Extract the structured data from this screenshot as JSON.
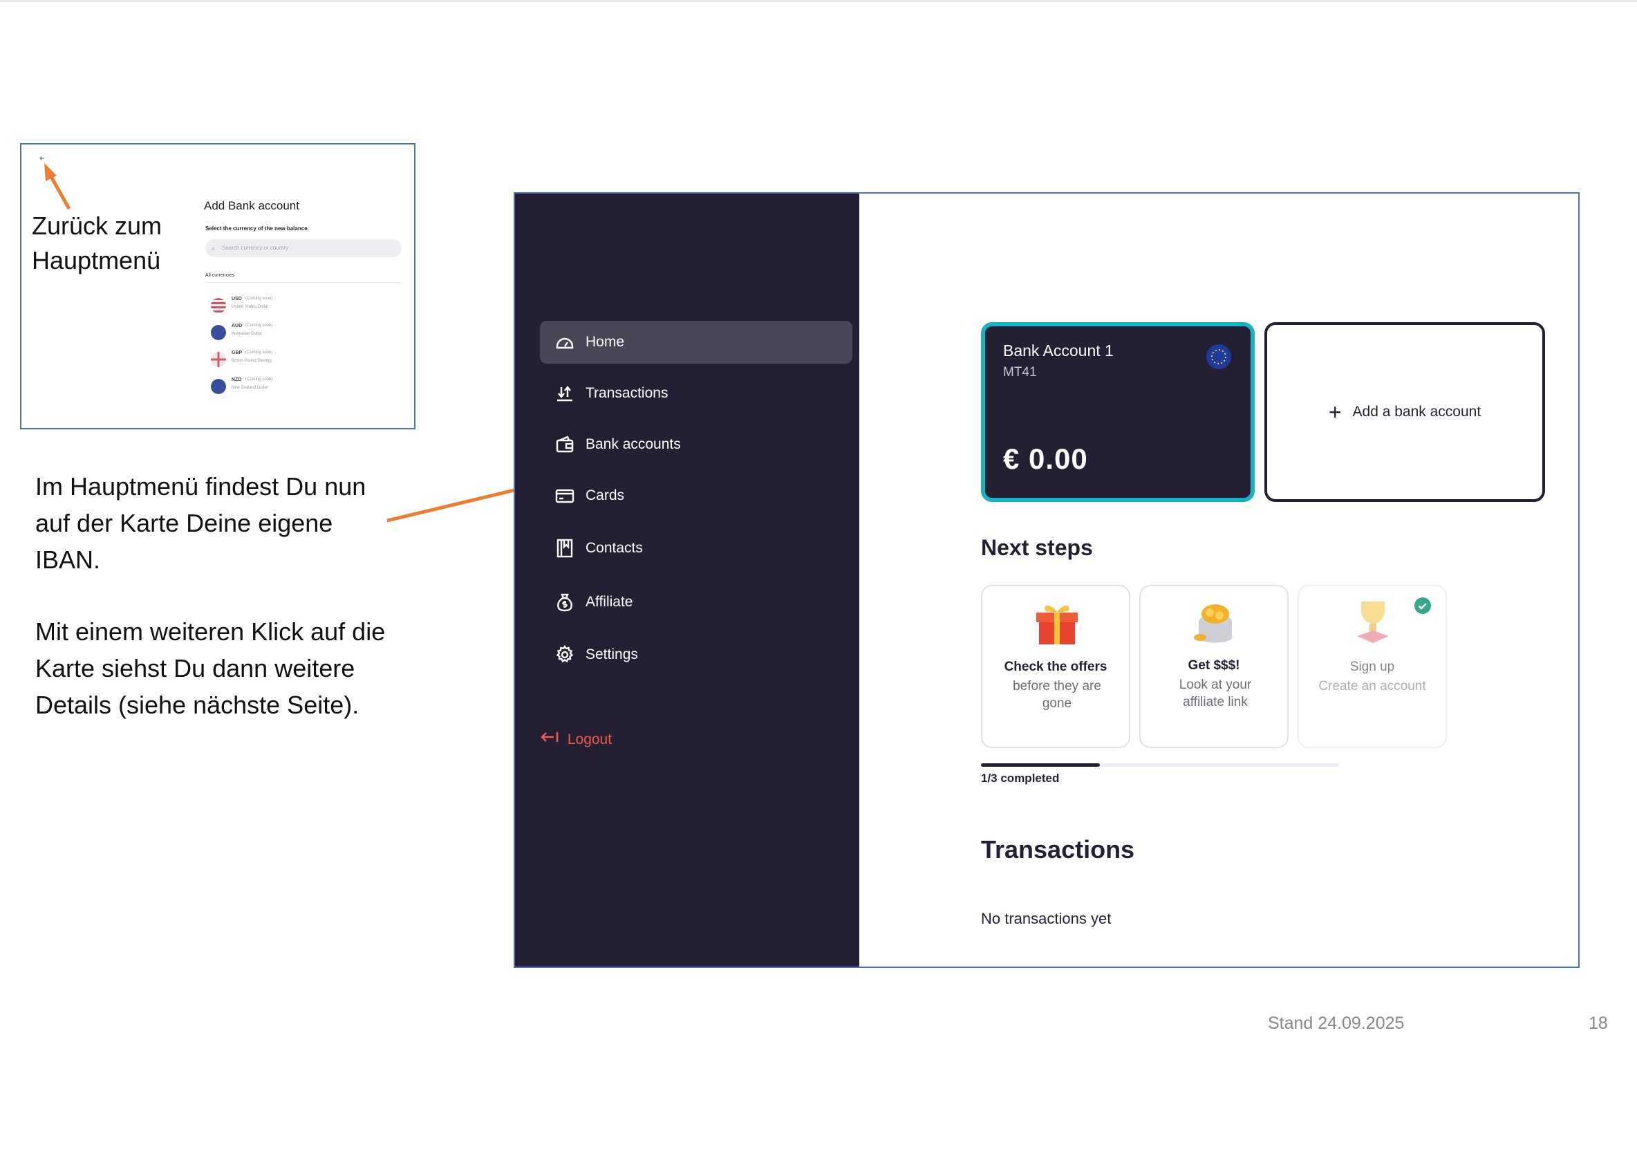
{
  "mini": {
    "title": "Add Bank account",
    "subtitle": "Select the currency of the new balance.",
    "search_placeholder": "Search currency or country",
    "all_label": "All currencies",
    "currencies": [
      {
        "code": "USD",
        "tag": "(Coming soon)",
        "name": "United States Dollar",
        "flag_color": "#c8505a"
      },
      {
        "code": "AUD",
        "tag": "(Coming soon)",
        "name": "Australian Dollar",
        "flag_color": "#3a4f9a"
      },
      {
        "code": "GBP",
        "tag": "(Coming soon)",
        "name": "British Pound Sterling",
        "flag_color": "#d45a64"
      },
      {
        "code": "NZD",
        "tag": "(Coming soon)",
        "name": "New Zealand Dollar",
        "flag_color": "#3a4f9a"
      }
    ]
  },
  "annotations": {
    "back_label_line1": "Zurück zum",
    "back_label_line2": "Hauptmenü",
    "para1_line1": "Im Hauptmenü findest Du nun",
    "para1_line2": "auf der Karte Deine eigene",
    "para1_line3": "IBAN.",
    "para2_line1": "Mit einem weiteren Klick auf die",
    "para2_line2": "Karte siehst Du dann weitere",
    "para2_line3": "Details (siehe nächste Seite)."
  },
  "sidebar": {
    "items": [
      {
        "label": "Home",
        "icon": "dashboard-icon",
        "active": true
      },
      {
        "label": "Transactions",
        "icon": "transfer-arrows-icon"
      },
      {
        "label": "Bank accounts",
        "icon": "wallet-icon"
      },
      {
        "label": "Cards",
        "icon": "credit-card-icon"
      },
      {
        "label": "Contacts",
        "icon": "contacts-book-icon"
      },
      {
        "label": "Affiliate",
        "icon": "money-bag-icon"
      },
      {
        "label": "Settings",
        "icon": "gear-icon"
      }
    ],
    "logout": "Logout"
  },
  "account_card": {
    "name": "Bank Account 1",
    "iban": "MT41",
    "balance": "€ 0.00",
    "flag_icon": "eu-flag-icon"
  },
  "add_account": {
    "label": "Add a bank account"
  },
  "next_steps": {
    "heading": "Next steps",
    "steps": [
      {
        "title": "Check the offers",
        "desc": "before they are gone",
        "icon": "gift-icon",
        "completed": false
      },
      {
        "title": "Get $$$!",
        "desc": "Look at your affiliate link",
        "icon": "coins-bag-icon",
        "completed": false
      },
      {
        "title": "Sign up",
        "desc": "Create an account",
        "icon": "trophy-icon",
        "completed": true
      }
    ],
    "progress_fraction": 0.333,
    "progress_label": "1/3 completed"
  },
  "transactions": {
    "heading": "Transactions",
    "empty": "No transactions yet"
  },
  "footer": {
    "date": "Stand 24.09.2025",
    "page": "18"
  },
  "colors": {
    "sidebar_bg": "#241f33",
    "card_border": "#18b3c2",
    "logout": "#f05a48",
    "arrow": "#ed7d31",
    "frame": "#4a72c4"
  }
}
